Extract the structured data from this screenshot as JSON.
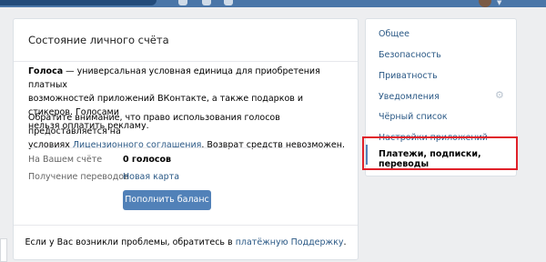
{
  "panel": {
    "title": "Состояние личного счёта",
    "info_bold": "Голоса",
    "info_line1": " — универсальная условная единица для приобретения платных",
    "info_line2": "возможностей приложений ВКонтакте, а также подарков и стикеров. Голосами",
    "info_line3": "нельзя оплатить рекламу.",
    "notice_line1": "Обратите внимание, что право использования голосов предоставляется на",
    "notice_prefix": "условиях ",
    "notice_link": "Лицензионного соглашения",
    "notice_suffix": ". Возврат средств невозможен.",
    "balance_label": "На Вашем счёте",
    "balance_value": "0 голосов",
    "transfers_label": "Получение переводов",
    "transfers_value": "Новая карта",
    "topup_button": "Пополнить баланс",
    "footer_prefix": "Если у Вас возникли проблемы, обратитесь в ",
    "footer_link": "платёжную Поддержку",
    "footer_suffix": "."
  },
  "menu": {
    "items": [
      "Общее",
      "Безопасность",
      "Приватность",
      "Уведомления",
      "Чёрный список",
      "Настройки приложений",
      "Платежи, подписки, переводы"
    ],
    "selected_index": 6,
    "gear_icon": "gear-icon"
  },
  "colors": {
    "header": "#4a76a8",
    "link": "#2a5885",
    "button": "#5181b8",
    "highlight": "#e0212a"
  }
}
